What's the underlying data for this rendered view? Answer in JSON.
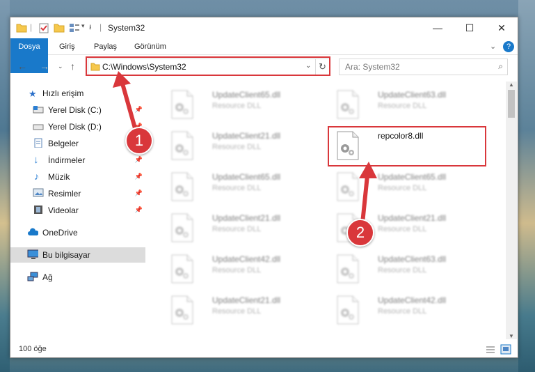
{
  "window": {
    "title": "System32"
  },
  "ribbon": {
    "tabs": [
      "Dosya",
      "Giriş",
      "Paylaş",
      "Görünüm"
    ]
  },
  "address": {
    "path": "C:\\Windows\\System32"
  },
  "search": {
    "placeholder": "Ara: System32"
  },
  "sidebar": {
    "items": [
      {
        "label": "Hızlı erişim"
      },
      {
        "label": "Yerel Disk (C:)"
      },
      {
        "label": "Yerel Disk (D:)"
      },
      {
        "label": "Belgeler"
      },
      {
        "label": "İndirmeler"
      },
      {
        "label": "Müzik"
      },
      {
        "label": "Resimler"
      },
      {
        "label": "Videolar"
      },
      {
        "label": "OneDrive"
      },
      {
        "label": "Bu bilgisayar"
      },
      {
        "label": "Ağ"
      }
    ]
  },
  "files": [
    {
      "name": "UpdateClient65.dll",
      "type": "Resource DLL"
    },
    {
      "name": "UpdateClient63.dll",
      "type": "Resource DLL"
    },
    {
      "name": "UpdateClient21.dll",
      "type": "Resource DLL"
    },
    {
      "name": "repcolor8.dll",
      "type": ""
    },
    {
      "name": "UpdateClient65.dll",
      "type": "Resource DLL"
    },
    {
      "name": "UpdateClient65.dll",
      "type": "Resource DLL"
    },
    {
      "name": "UpdateClient21.dll",
      "type": "Resource DLL"
    },
    {
      "name": "UpdateClient21.dll",
      "type": "Resource DLL"
    },
    {
      "name": "UpdateClient42.dll",
      "type": "Resource DLL"
    },
    {
      "name": "UpdateClient63.dll",
      "type": "Resource DLL"
    },
    {
      "name": "UpdateClient21.dll",
      "type": "Resource DLL"
    },
    {
      "name": "UpdateClient42.dll",
      "type": "Resource DLL"
    }
  ],
  "status": {
    "count": "100 öğe"
  },
  "annotations": {
    "step1": "1",
    "step2": "2"
  },
  "colors": {
    "accent": "#1979ca",
    "highlight": "#d9373b"
  }
}
